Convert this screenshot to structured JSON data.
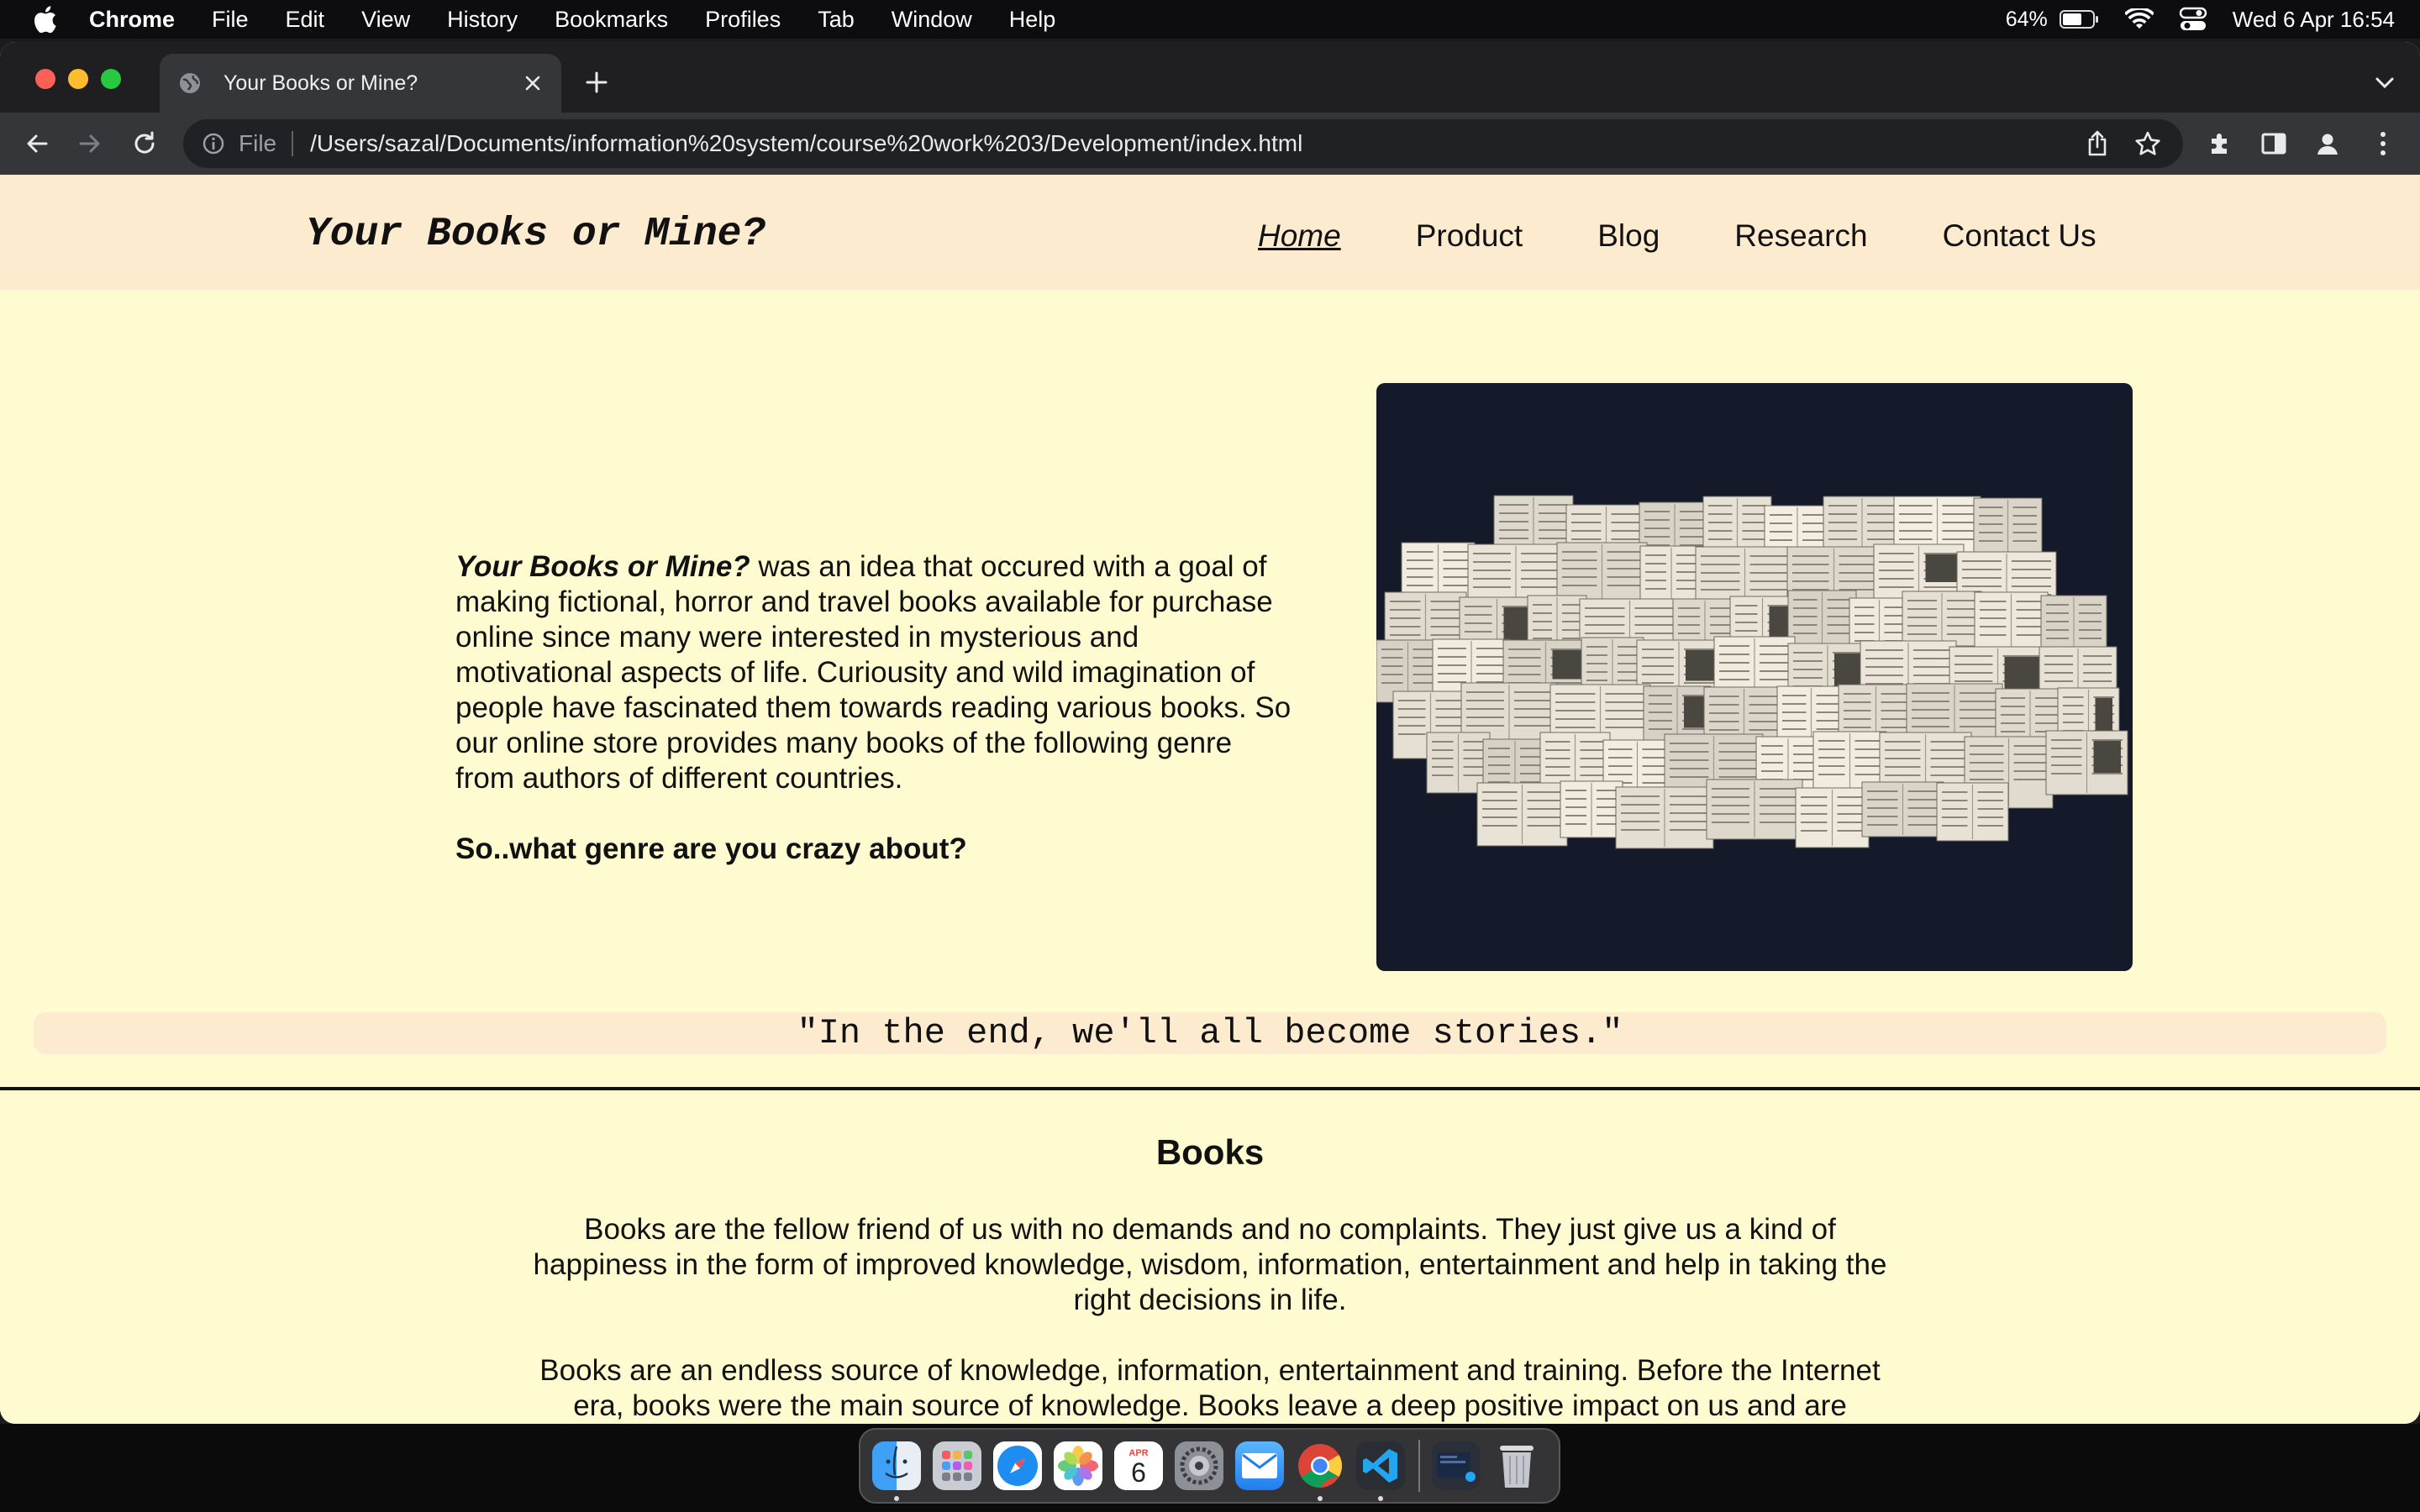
{
  "menubar": {
    "app_name": "Chrome",
    "items": [
      "File",
      "Edit",
      "View",
      "History",
      "Bookmarks",
      "Profiles",
      "Tab",
      "Window",
      "Help"
    ],
    "battery_percent": "64%",
    "clock": "Wed 6 Apr  16:54",
    "status_icons": [
      "battery-icon",
      "wifi-icon",
      "control-center-icon"
    ]
  },
  "browser": {
    "tab_title": "Your Books or Mine?",
    "omnibox_scheme": "File",
    "url": "/Users/sazal/Documents/information%20system/course%20work%203/Development/index.html",
    "toolbar_icons": [
      "back-icon",
      "forward-icon",
      "reload-icon",
      "share-icon",
      "star-icon",
      "extensions-icon",
      "side-panel-icon",
      "profile-icon",
      "menu-icon"
    ]
  },
  "site": {
    "logo": "Your Books or Mine?",
    "nav": [
      "Home",
      "Product",
      "Blog",
      "Research",
      "Contact Us"
    ],
    "active_nav": "Home",
    "intro": {
      "brand": "Your Books or Mine?",
      "text": " was an idea that occured with a goal of making fictional, horror and travel books available for purchase online since many were interested in mysterious and motivational aspects of life. Curiousity and wild imagination of people have fascinated them towards reading various books. So our online store provides many books of the following genre from authors of different countries.",
      "question": "So..what genre are you crazy about?"
    },
    "quote": "\"In the end, we'll all become stories.\"",
    "books": {
      "heading": "Books",
      "para1": "Books are the fellow friend of us with no demands and no complaints. They just give us a kind of happiness in the form of improved knowledge, wisdom, information, entertainment and help in taking the right decisions in life.",
      "para2": "Books are an endless source of knowledge, information, entertainment and training. Before the Internet era, books were the main source of knowledge. Books leave a deep positive impact on us and are responsible for raising our spirit. Books gives us new prospective and provides deeper"
    },
    "colors": {
      "page_bg": "#fffbd0",
      "header_bg": "#fdebd0",
      "hero_bg": "#141a2a"
    }
  },
  "dock": {
    "apps": [
      "finder-icon",
      "launchpad-icon",
      "safari-icon",
      "photos-icon",
      "calendar-icon",
      "system-preferences-icon",
      "mail-icon",
      "chrome-icon",
      "vscode-icon",
      "downloads-stack-icon",
      "trash-icon"
    ],
    "calendar_month": "APR",
    "calendar_day": "6"
  }
}
